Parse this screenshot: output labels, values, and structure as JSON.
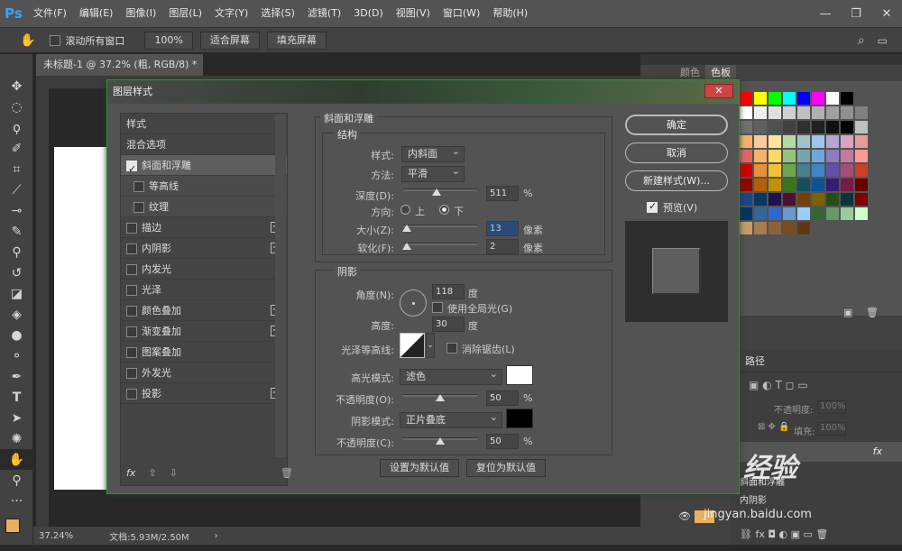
{
  "app": {
    "logo": "Ps",
    "doc_tab": "未标题-1 @ 37.2% (粗, RGB/8) *",
    "zoom": "37.24%",
    "doc_size": "文档:5.93M/2.50M"
  },
  "menu": [
    "文件(F)",
    "编辑(E)",
    "图像(I)",
    "图层(L)",
    "文字(Y)",
    "选择(S)",
    "滤镜(T)",
    "3D(D)",
    "视图(V)",
    "窗口(W)",
    "帮助(H)"
  ],
  "options": {
    "scroll_all": "滚动所有窗口",
    "zoom_btn": "100%",
    "fit_btn": "适合屏幕",
    "fill_btn": "填充屏幕"
  },
  "panels": {
    "color_tab": "颜色",
    "swatch_tab": "色板",
    "paths_tab": "路径",
    "opacity_label": "不透明度:",
    "opacity_value": "100%",
    "fill_label": "填充:",
    "fill_value": "100%",
    "layer_fx": "fx",
    "layer_sub1": "斜面和浮雕",
    "layer_sub2": "内阴影",
    "layer_name": "j...",
    "watermark": "Bai 经验",
    "watermark_sub": "jingyan.baidu.com"
  },
  "dialog": {
    "title": "图层样式",
    "close": "✕",
    "list": [
      {
        "label": "样式",
        "check": false,
        "plus": false,
        "sel": false,
        "sub": false,
        "nochk": true
      },
      {
        "label": "混合选项",
        "check": false,
        "plus": false,
        "sel": false,
        "sub": false,
        "nochk": true
      },
      {
        "label": "斜面和浮雕",
        "check": true,
        "plus": false,
        "sel": true,
        "sub": false
      },
      {
        "label": "等高线",
        "check": false,
        "plus": false,
        "sel": false,
        "sub": true
      },
      {
        "label": "纹理",
        "check": false,
        "plus": false,
        "sel": false,
        "sub": true
      },
      {
        "label": "描边",
        "check": false,
        "plus": true
      },
      {
        "label": "内阴影",
        "check": false,
        "plus": true
      },
      {
        "label": "内发光",
        "check": false,
        "plus": false
      },
      {
        "label": "光泽",
        "check": false,
        "plus": false
      },
      {
        "label": "颜色叠加",
        "check": false,
        "plus": true
      },
      {
        "label": "渐变叠加",
        "check": false,
        "plus": true
      },
      {
        "label": "图案叠加",
        "check": false,
        "plus": false
      },
      {
        "label": "外发光",
        "check": false,
        "plus": false
      },
      {
        "label": "投影",
        "check": false,
        "plus": true
      }
    ],
    "list_foot_fx": "fx",
    "bevel": {
      "group_title": "斜面和浮雕",
      "struct_title": "结构",
      "style_label": "样式:",
      "style_value": "内斜面",
      "method_label": "方法:",
      "method_value": "平滑",
      "depth_label": "深度(D):",
      "depth_value": "511",
      "depth_unit": "%",
      "depth_pct": 0.45,
      "dir_label": "方向:",
      "dir_up": "上",
      "dir_down": "下",
      "size_label": "大小(Z):",
      "size_value": "13",
      "size_unit": "像素",
      "size_pct": 0.05,
      "soften_label": "软化(F):",
      "soften_value": "2",
      "soften_unit": "像素",
      "soften_pct": 0.05
    },
    "shading": {
      "title": "阴影",
      "angle_label": "角度(N):",
      "angle_value": "118",
      "deg": "度",
      "global_light": "使用全局光(G)",
      "alt_label": "高度:",
      "alt_value": "30",
      "gloss_label": "光泽等高线:",
      "antialias": "消除锯齿(L)",
      "hl_mode_label": "高光模式:",
      "hl_mode": "滤色",
      "hl_color": "#ffffff",
      "hl_op_label": "不透明度(O):",
      "hl_op": "50",
      "pct": "%",
      "hl_op_pct": 0.5,
      "sh_mode_label": "阴影模式:",
      "sh_mode": "正片叠底",
      "sh_color": "#000000",
      "sh_op_label": "不透明度(C):",
      "sh_op": "50",
      "sh_op_pct": 0.5
    },
    "set_default": "设置为默认值",
    "reset_default": "复位为默认值",
    "ok": "确定",
    "cancel": "取消",
    "new_style": "新建样式(W)...",
    "preview": "预览(V)"
  }
}
